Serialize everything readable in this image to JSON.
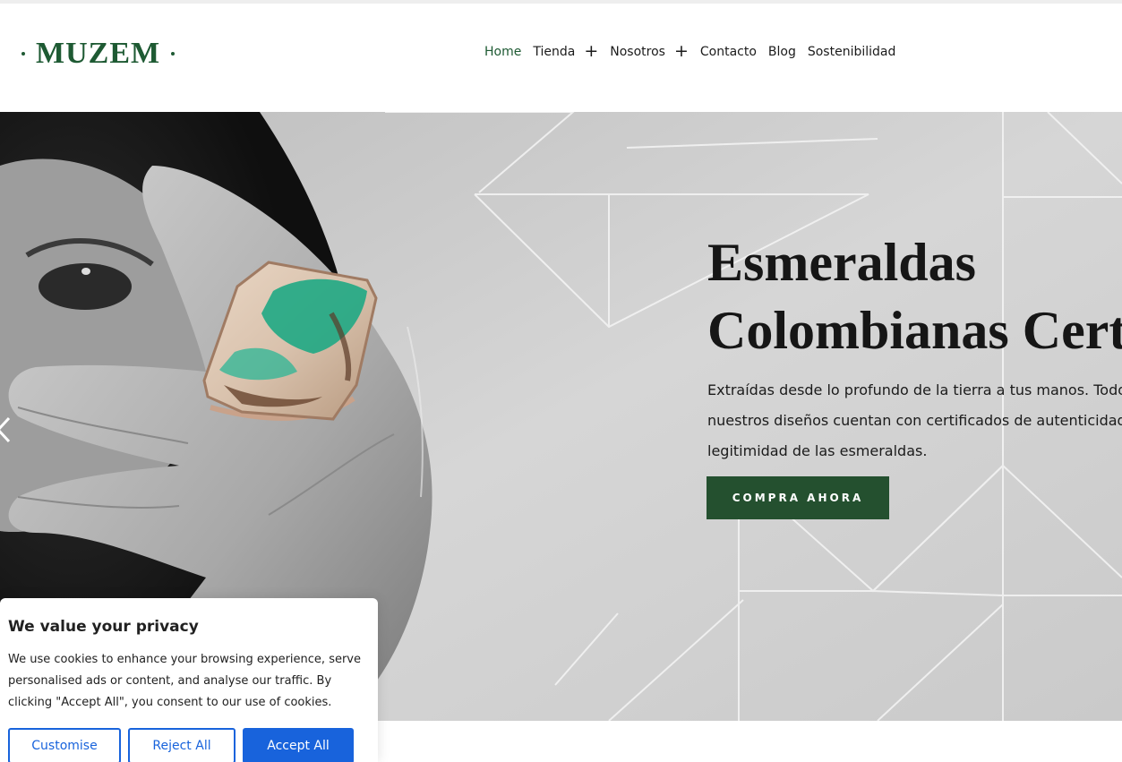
{
  "logo": {
    "text": "MUZEM"
  },
  "nav": {
    "items": [
      {
        "label": "Home",
        "active": true,
        "has_submenu": false
      },
      {
        "label": "Tienda",
        "active": false,
        "has_submenu": true
      },
      {
        "label": "Nosotros",
        "active": false,
        "has_submenu": true
      },
      {
        "label": "Contacto",
        "active": false,
        "has_submenu": false
      },
      {
        "label": "Blog",
        "active": false,
        "has_submenu": false
      },
      {
        "label": "Sostenibilidad",
        "active": false,
        "has_submenu": false
      }
    ],
    "submenu_icon": "plus-icon"
  },
  "hero": {
    "title_line1": "Esmeraldas",
    "title_line2": "Colombianas Certi",
    "desc_line1": "Extraídas desde lo profundo de la tierra a tus manos. Todos",
    "desc_line2": "nuestros diseños cuentan con certificados de autenticidad y",
    "desc_line3": "legitimidad de las esmeraldas.",
    "cta_label": "COMPRA AHORA",
    "prev_icon": "chevron-left-icon"
  },
  "cookie": {
    "title": "We value your privacy",
    "text": "We use cookies to enhance your browsing experience, serve personalised ads or content, and analyse our traffic. By clicking \"Accept All\", you consent to our use of cookies.",
    "customise_label": "Customise",
    "reject_label": "Reject All",
    "accept_label": "Accept All"
  },
  "colors": {
    "brand_green": "#1e5a33",
    "cta_green": "#24502f",
    "cookie_blue": "#1863dc",
    "emerald": "#1fa884"
  }
}
